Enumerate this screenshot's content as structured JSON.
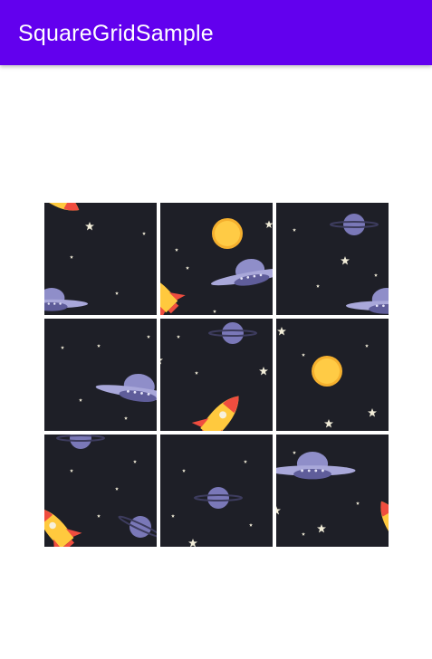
{
  "app_bar": {
    "title": "SquareGridSample",
    "color": "#6200EE"
  },
  "grid": {
    "rows": 3,
    "columns": 3,
    "tile_background": "#1e1f27",
    "image_theme": "space pattern: rockets, UFOs, planets, suns, stars",
    "icons": [
      "rocket-icon",
      "ufo-icon",
      "planet-icon",
      "sun-icon",
      "star-icon"
    ]
  }
}
